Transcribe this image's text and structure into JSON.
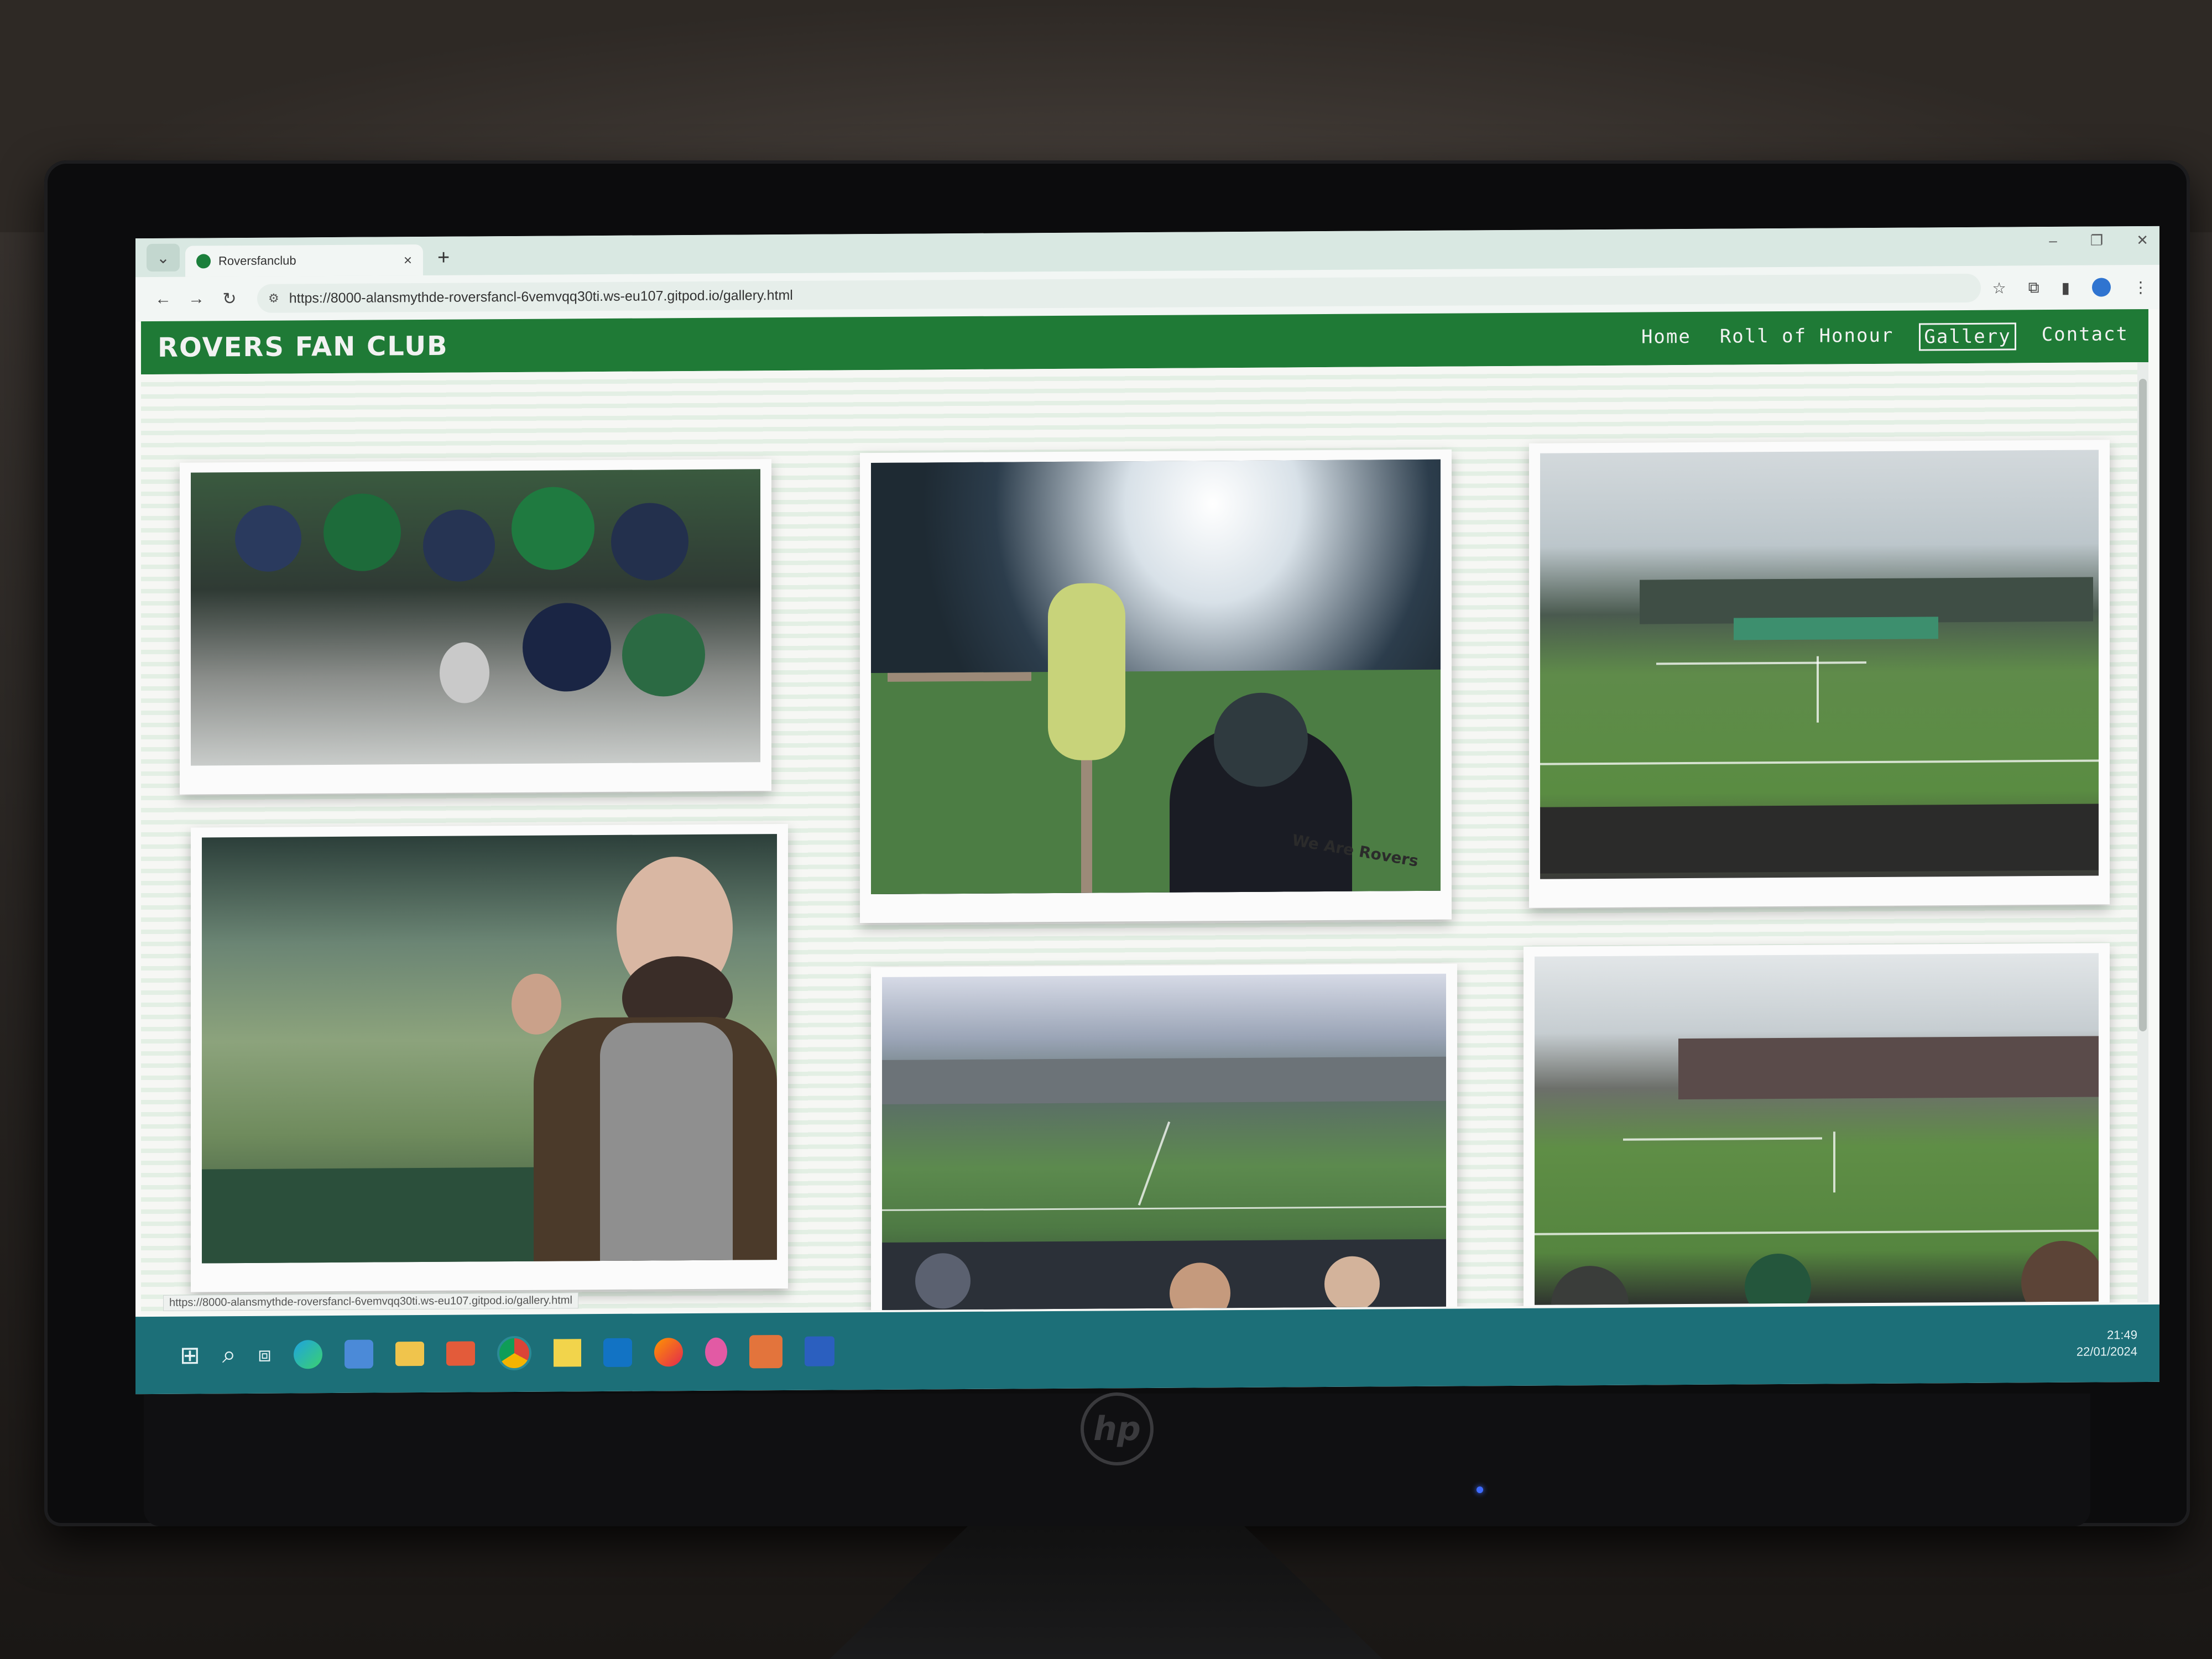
{
  "browser": {
    "tab_title": "Roversfanclub",
    "url": "https://8000-alansmythde-roversfancl-6vemvqq30ti.ws-eu107.gitpod.io/gallery.html",
    "status_url": "https://8000-alansmythde-roversfancl-6vemvqq30ti.ws-eu107.gitpod.io/gallery.html",
    "new_tab": "+",
    "close": "×",
    "minimize": "–",
    "restore": "❐",
    "win_close": "✕",
    "back": "←",
    "forward": "→",
    "reload": "↻",
    "star": "☆",
    "menu": "⋮"
  },
  "site": {
    "brand": "ROVERS FAN CLUB",
    "nav": [
      {
        "label": "Home"
      },
      {
        "label": "Roll of Honour"
      },
      {
        "label": "Gallery"
      },
      {
        "label": "Contact"
      }
    ],
    "active_nav": "Gallery",
    "gallery_banner": "We Are Rovers"
  },
  "taskbar": {
    "time": "21:49",
    "date": "22/01/2024",
    "apps": [
      "start-icon",
      "search-icon",
      "task-view-icon",
      "edge-icon",
      "people-icon",
      "file-explorer-icon",
      "files-icon",
      "chrome-icon",
      "sticky-notes-icon",
      "outlook-icon",
      "firefox-icon",
      "paint-icon",
      "slack-icon",
      "word-icon"
    ]
  },
  "monitor": {
    "brand": "hp"
  },
  "colors": {
    "nav_green": "#1f7a36",
    "taskbar": "#1c6f78"
  }
}
